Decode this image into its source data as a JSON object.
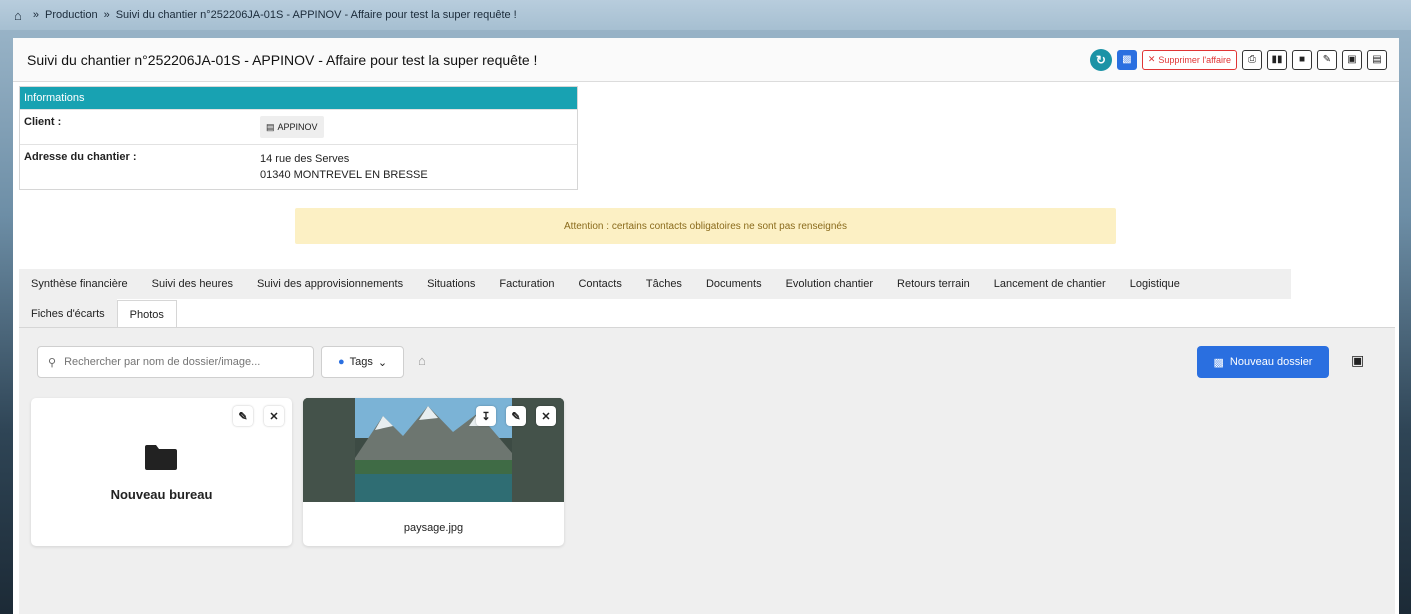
{
  "breadcrumb": {
    "items": [
      "Production",
      "Suivi du chantier n°252206JA-01S - APPINOV - Affaire pour test la super requête !"
    ],
    "separator": "»"
  },
  "header": {
    "title": "Suivi du chantier n°252206JA-01S - APPINOV - Affaire pour test la super requête !",
    "delete_label": "Supprimer l'affaire"
  },
  "info": {
    "heading": "Informations",
    "client_label": "Client :",
    "client_value": "APPINOV",
    "address_label": "Adresse du chantier :",
    "address_line1": "14 rue des Serves",
    "address_line2": "01340 MONTREVEL EN BRESSE"
  },
  "alert": "Attention : certains contacts obligatoires ne sont pas renseignés",
  "tabs": {
    "row1": [
      "Synthèse financière",
      "Suivi des heures",
      "Suivi des approvisionnements",
      "Situations",
      "Facturation",
      "Contacts",
      "Tâches",
      "Documents",
      "Evolution chantier",
      "Retours terrain",
      "Lancement de chantier",
      "Logistique"
    ],
    "row2": [
      "Fiches d'écarts",
      "Photos"
    ],
    "active": "Photos"
  },
  "photos": {
    "search_placeholder": "Rechercher par nom de dossier/image...",
    "tags_label": "Tags",
    "new_folder_label": "Nouveau dossier",
    "folder_name": "Nouveau bureau",
    "photo_name": "paysage.jpg"
  },
  "colors": {
    "accent": "#18a2b2",
    "primary": "#2a6fe0",
    "danger": "#e03535",
    "alert_bg": "#fcf0c4"
  }
}
